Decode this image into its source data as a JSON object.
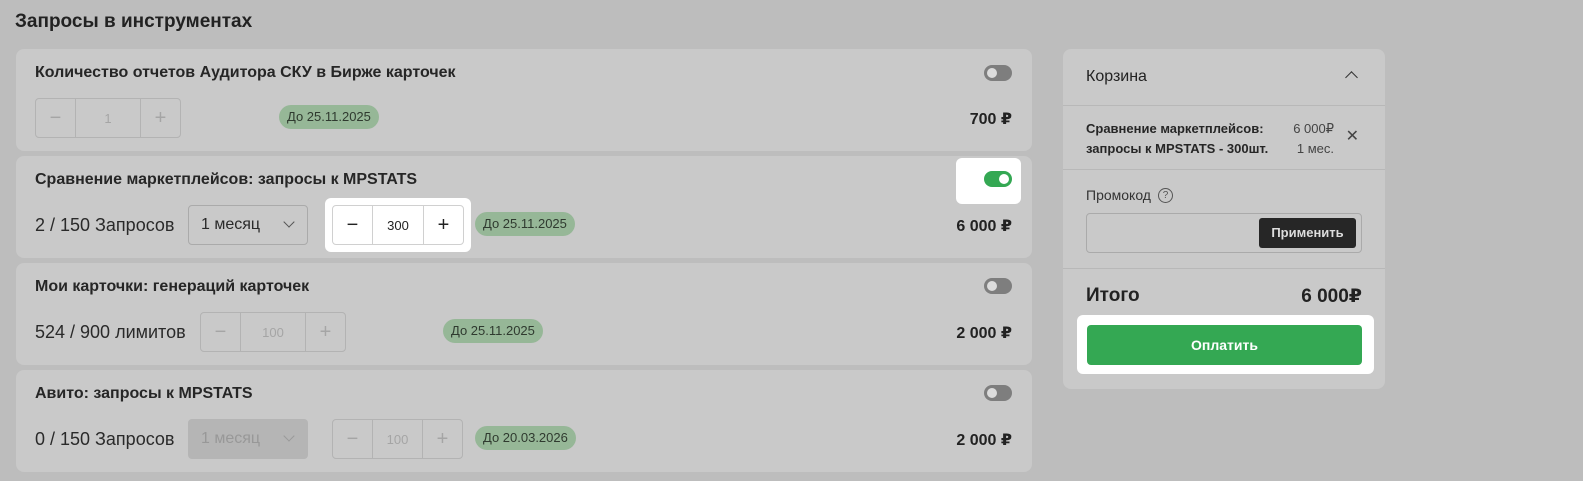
{
  "page_title": "Запросы в инструментах",
  "cards": [
    {
      "title": "Количество отчетов Аудитора СКУ в Бирже карточек",
      "enabled": false,
      "stepper": {
        "minus": "−",
        "value": "1",
        "plus": "+"
      },
      "badge": "До 25.11.2025",
      "price": "700 ₽"
    },
    {
      "title": "Сравнение маркетплейсов: запросы к MPSTATS",
      "enabled": true,
      "usage": "2 / 150 Запросов",
      "period": "1 месяц",
      "stepper": {
        "minus": "−",
        "value": "300",
        "plus": "+"
      },
      "badge": "До 25.11.2025",
      "price": "6 000 ₽"
    },
    {
      "title": "Мои карточки: генераций карточек",
      "enabled": false,
      "usage": "524 / 900 лимитов",
      "stepper": {
        "minus": "−",
        "value": "100",
        "plus": "+"
      },
      "badge": "До 25.11.2025",
      "price": "2 000 ₽"
    },
    {
      "title": "Авито: запросы к MPSTATS",
      "enabled": false,
      "usage": "0 / 150 Запросов",
      "period": "1 месяц",
      "stepper": {
        "minus": "−",
        "value": "100",
        "plus": "+"
      },
      "badge": "До 20.03.2026",
      "price": "2 000 ₽"
    }
  ],
  "cart": {
    "title": "Корзина",
    "item": {
      "name_line1": "Сравнение маркетплейсов:",
      "name_line2": "запросы к MPSTATS - 300шт.",
      "price": "6 000₽",
      "period": "1 мес.",
      "remove": "✕"
    },
    "promo_label": "Промокод",
    "help": "?",
    "apply_label": "Применить",
    "total_label": "Итого",
    "total_value": "6 000₽",
    "pay_label": "Оплатить"
  },
  "icons": {
    "collapse": "chevron-up-icon",
    "remove": "close-icon",
    "help": "help-circle-icon",
    "dropdown": "chevron-down-icon"
  },
  "colors": {
    "accent": "#34a853",
    "badge": "#96b797",
    "apply_button": "#262626"
  }
}
